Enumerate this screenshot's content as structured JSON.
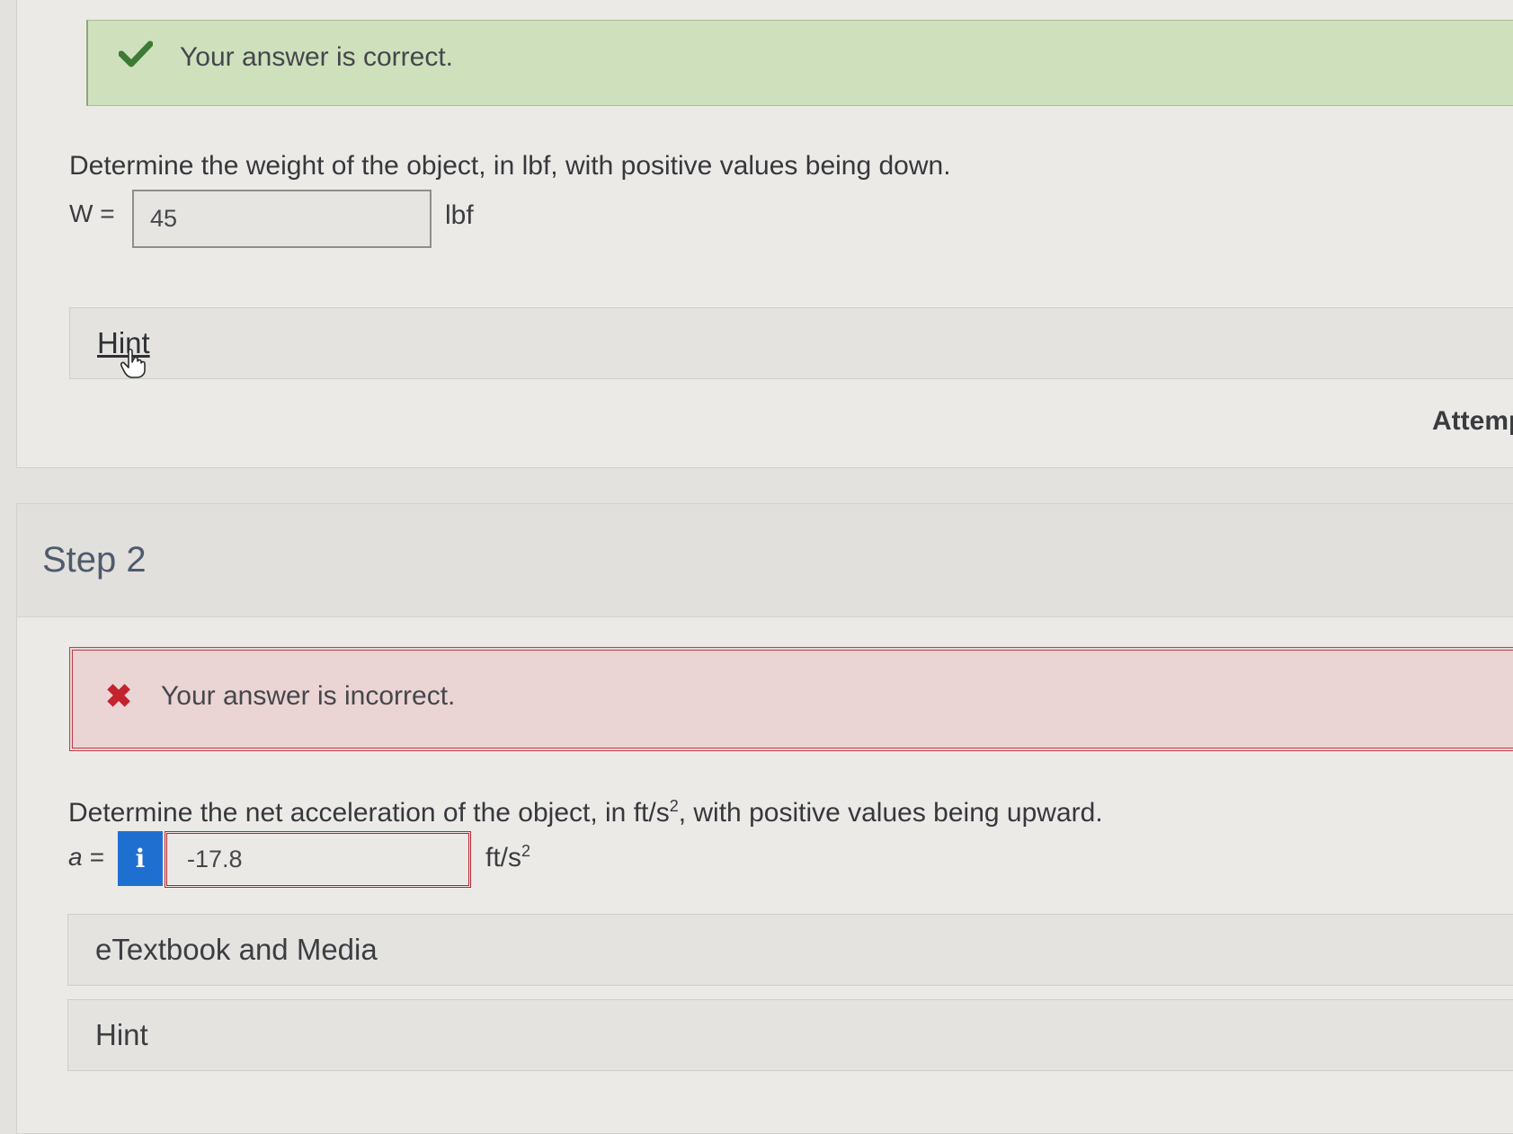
{
  "step1": {
    "feedback": "Your answer is correct.",
    "question": "Determine the weight of the object, in lbf, with positive values being down.",
    "var_label": "W =",
    "answer_value": "45",
    "unit": "lbf",
    "hint_label": "Hint",
    "attempts_label": "Attempts"
  },
  "step2": {
    "title": "Step 2",
    "feedback": "Your answer is incorrect.",
    "question_prefix": "Determine the net acceleration of the object, in ft/s",
    "question_sup": "2",
    "question_suffix": ", with positive values being upward.",
    "var_label": "a =",
    "info_icon": "i",
    "answer_value": "-17.8",
    "unit_base": "ft/s",
    "unit_sup": "2",
    "etextbook_label": "eTextbook and Media",
    "hint_label": "Hint"
  },
  "colors": {
    "correct_bg": "#cfe0bd",
    "incorrect_bg": "#ebd4d4",
    "incorrect_border": "#b8404a",
    "info_button": "#1f6fd1",
    "check_icon": "#3d7a36",
    "x_icon": "#c2232c"
  },
  "icons": [
    "checkmark-icon",
    "x-mark-icon",
    "info-icon",
    "hand-cursor-icon"
  ]
}
